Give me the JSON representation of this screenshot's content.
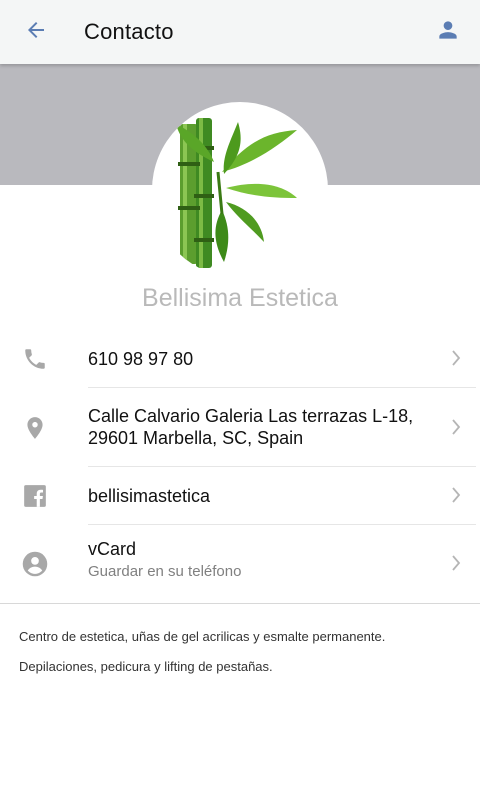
{
  "appbar": {
    "title": "Contacto",
    "back_icon": "arrow-left-icon",
    "profile_icon": "person-icon",
    "accent": "#5b7db3"
  },
  "profile": {
    "name": "Bellisima Estetica",
    "cover_color": "#b9b9be",
    "logo": "bamboo-logo"
  },
  "contacts": [
    {
      "icon": "phone-icon",
      "primary": "610 98 97 80"
    },
    {
      "icon": "location-pin-icon",
      "primary_line1": "Calle Calvario Galeria Las terrazas L-18,",
      "primary_line2": "29601 Marbella, SC, Spain"
    },
    {
      "icon": "facebook-icon",
      "primary": "bellisimastetica"
    },
    {
      "icon": "account-circle-icon",
      "primary": "vCard",
      "secondary": "Guardar en su teléfono"
    }
  ],
  "description": {
    "line1": "Centro de estetica, uñas de gel acrilicas y esmalte permanente.",
    "line2": "Depilaciones, pedicura y lifting de pestañas."
  }
}
